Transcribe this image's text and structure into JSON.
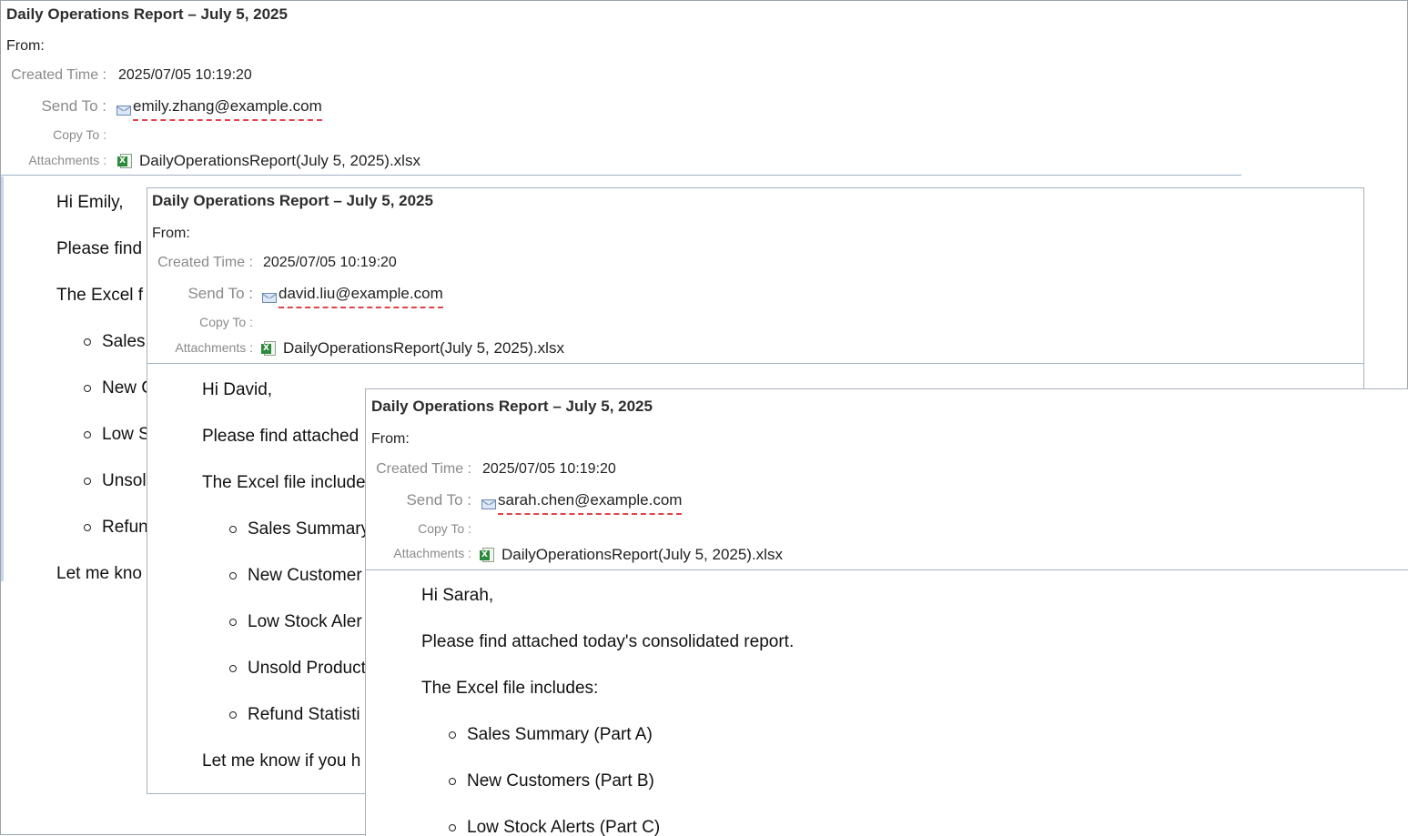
{
  "labels": {
    "from": "From:",
    "created_time": "Created Time :",
    "send_to": "Send To :",
    "copy_to": "Copy To :",
    "attachments": "Attachments :"
  },
  "emails": [
    {
      "subject": "Daily Operations Report – July 5, 2025",
      "created_time": "2025/07/05 10:19:20",
      "send_to": "emily.zhang@example.com",
      "copy_to": "",
      "attachment": "DailyOperationsReport(July 5, 2025).xlsx",
      "greeting": "Hi  Emily,",
      "line1": "Please find",
      "line2": "The Excel f",
      "items": [
        "Sales",
        "New C",
        "Low S",
        "Unsol",
        "Refun"
      ],
      "closing": "Let me kno"
    },
    {
      "subject": "Daily Operations Report – July 5, 2025",
      "created_time": "2025/07/05 10:19:20",
      "send_to": "david.liu@example.com",
      "copy_to": "",
      "attachment": "DailyOperationsReport(July 5, 2025).xlsx",
      "greeting": "Hi  David,",
      "line1": "Please find attached",
      "line2": "The Excel file include",
      "items": [
        "Sales Summary",
        "New Customer",
        "Low Stock Aler",
        "Unsold Product",
        "Refund Statisti"
      ],
      "closing": "Let me know if you h"
    },
    {
      "subject": "Daily Operations Report – July 5, 2025",
      "created_time": "2025/07/05 10:19:20",
      "send_to": "sarah.chen@example.com",
      "copy_to": "",
      "attachment": "DailyOperationsReport(July 5, 2025).xlsx",
      "greeting": "Hi  Sarah,",
      "line1": "Please find attached today's consolidated report.",
      "line2": "The Excel file includes:",
      "items": [
        "Sales Summary (Part A)",
        "New Customers (Part B)",
        "Low Stock Alerts (Part C)"
      ]
    }
  ],
  "icons": {
    "recipient": "mail-envelope-icon",
    "attachment": "excel-file-icon"
  },
  "colors": {
    "recipient_underline": "#e0444a",
    "divider": "#9fb2c8",
    "excel_green": "#2c8a3d"
  }
}
